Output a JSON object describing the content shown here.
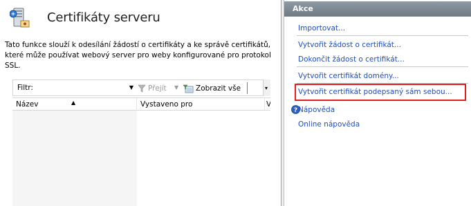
{
  "header": {
    "title": "Certifikáty serveru",
    "description": "Tato funkce slouží k odesílání žádostí o certifikáty a ke správě certifikátů, které může používat webový server pro weby konfigurované pro protokol SSL."
  },
  "toolbar": {
    "filter_label": "Filtr:",
    "filter_value": "",
    "go_label": "Přejít",
    "show_all_label": "Zobrazit vše"
  },
  "columns": {
    "name": "Název",
    "issued_to": "Vystaveno pro",
    "extra": "Vy"
  },
  "actions": {
    "title": "Akce",
    "import": "Importovat...",
    "create_request": "Vytvořit žádost o certifikát...",
    "complete_request": "Dokončit žádost o certifikát...",
    "create_domain": "Vytvořit certifikát domény...",
    "create_self_signed": "Vytvořit certifikát podepsaný sám sebou...",
    "help": "Nápověda",
    "online_help": "Online nápověda"
  },
  "colors": {
    "link": "#1f4ebf",
    "highlight": "#e41e1e",
    "actions_header": "#7b868f"
  }
}
